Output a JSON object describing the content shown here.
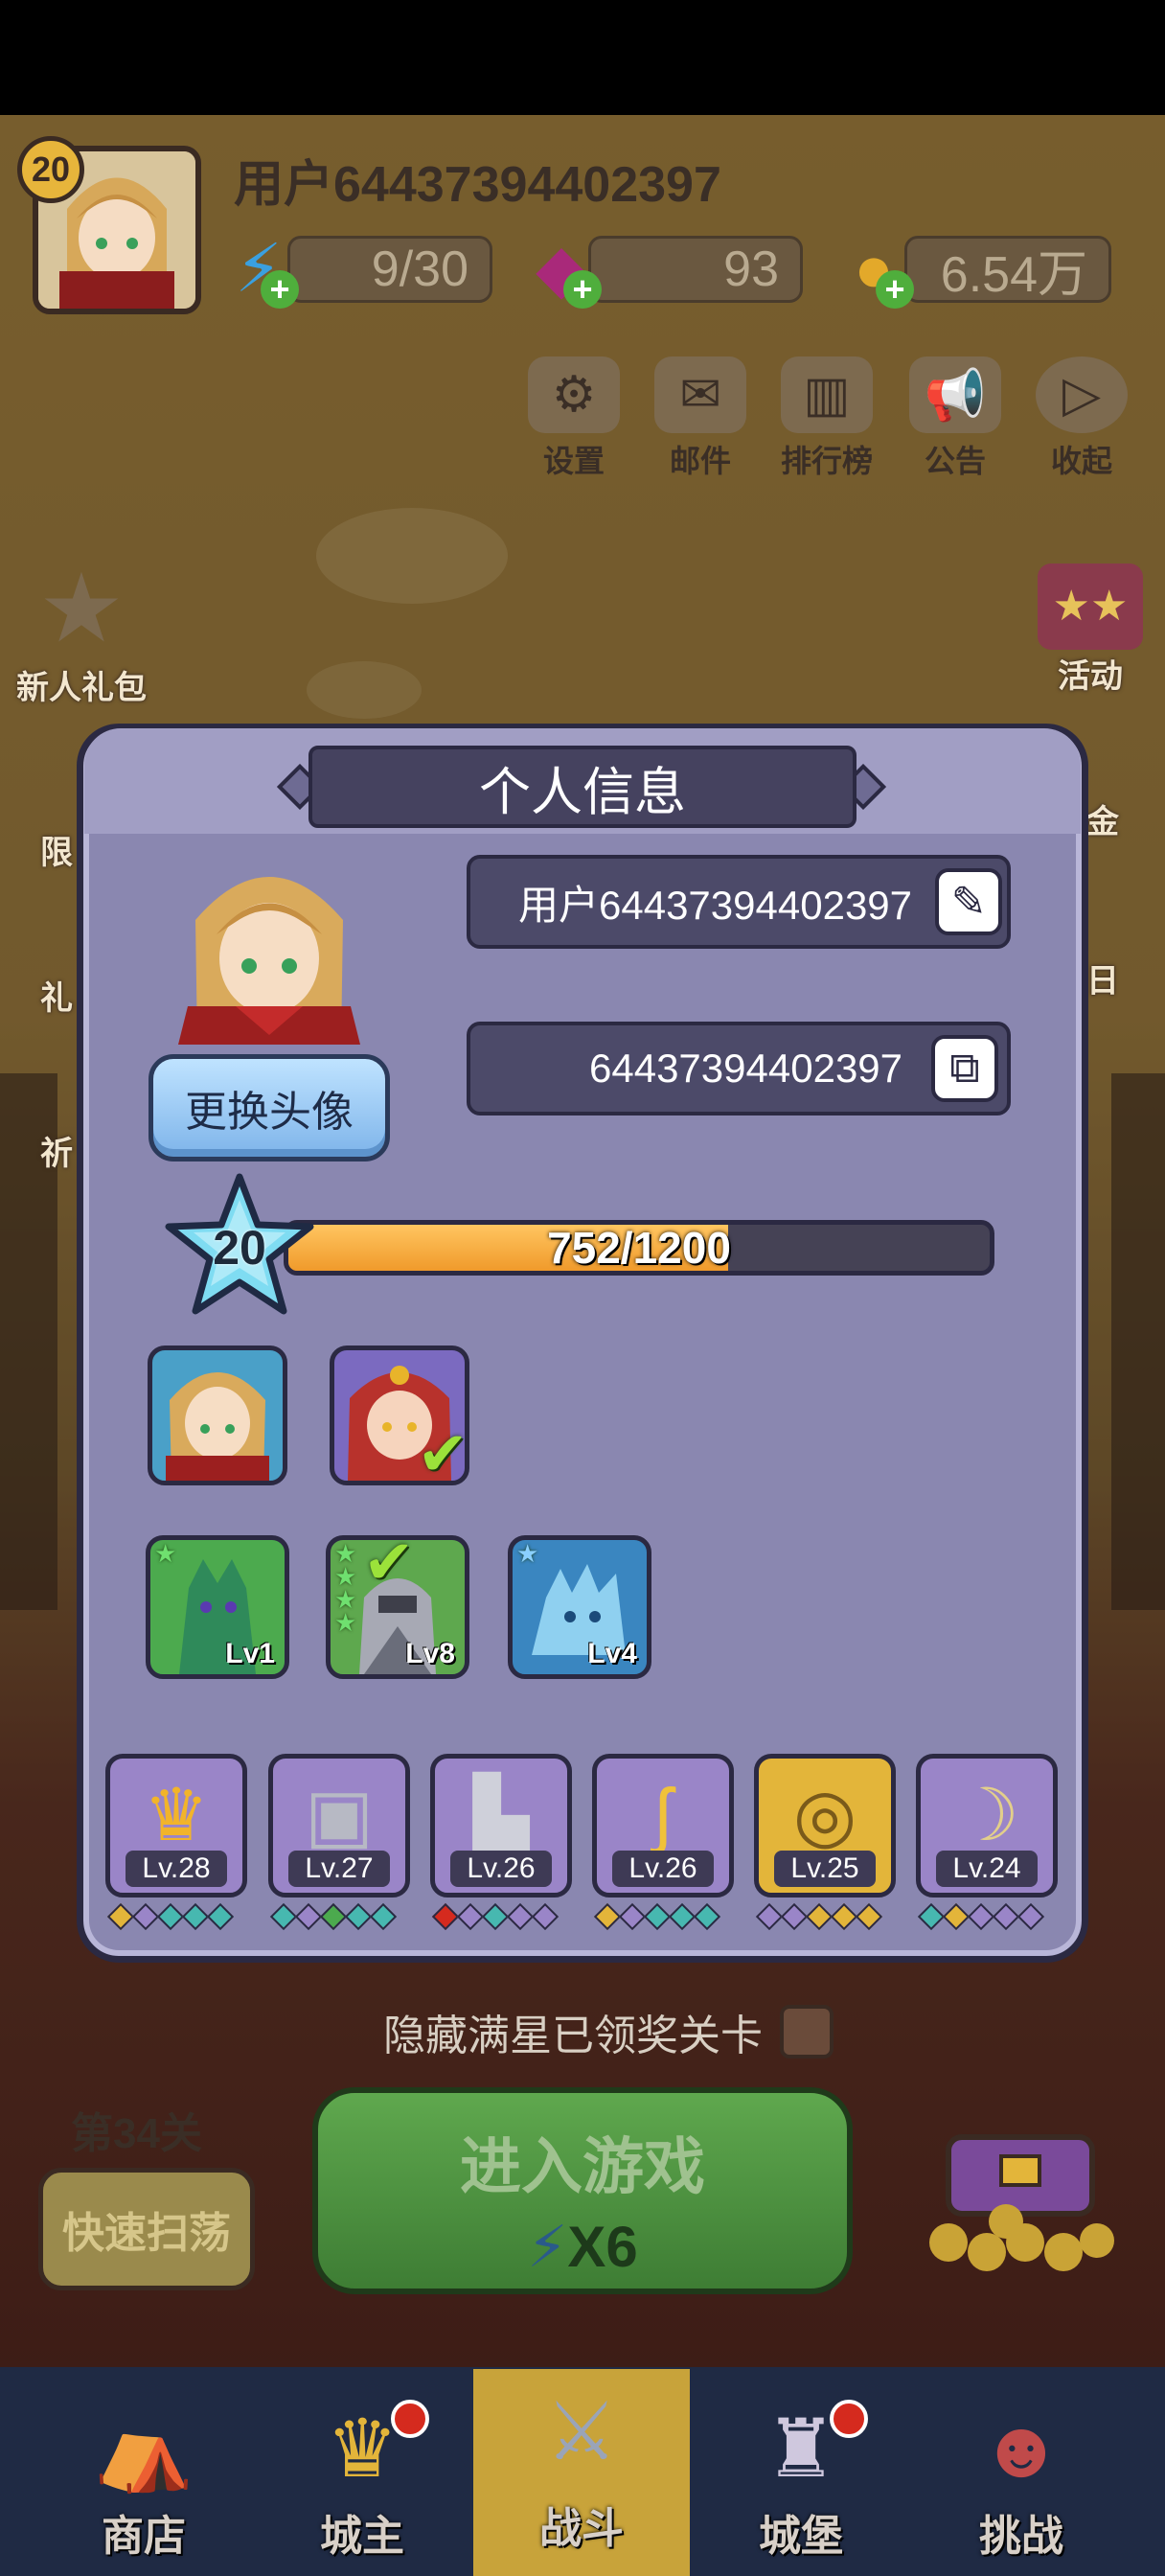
{
  "player": {
    "level": "20",
    "username": "用户64437394402397"
  },
  "resources": {
    "energy": "9/30",
    "gems": "93",
    "coins": "6.54万"
  },
  "top_buttons": [
    {
      "label": "设置",
      "icon": "gear-icon"
    },
    {
      "label": "邮件",
      "icon": "mail-icon"
    },
    {
      "label": "排行榜",
      "icon": "ranking-icon"
    },
    {
      "label": "公告",
      "icon": "megaphone-icon"
    },
    {
      "label": "收起",
      "icon": "collapse-icon"
    }
  ],
  "side_left": [
    {
      "label": "新人礼包"
    },
    {
      "label": "限"
    },
    {
      "label": "礼"
    },
    {
      "label": "祈"
    }
  ],
  "side_right": [
    {
      "label": "活动"
    },
    {
      "label": "金"
    },
    {
      "label": "日"
    }
  ],
  "profile_modal": {
    "title": "个人信息",
    "name_field": "用户64437394402397",
    "id_field": "64437394402397",
    "change_avatar_label": "更换头像",
    "level": "20",
    "xp_text": "752/1200",
    "xp_current": 752,
    "xp_max": 1200,
    "heroes": [
      {
        "name": "hero-slot-elf",
        "selected": false
      },
      {
        "name": "hero-slot-redhead",
        "selected": true
      }
    ],
    "pets": [
      {
        "level": "Lv1",
        "stars": 1,
        "selected": false
      },
      {
        "level": "Lv8",
        "stars": 4,
        "selected": true
      },
      {
        "level": "Lv4",
        "stars": 1,
        "selected": false
      }
    ],
    "equipment": [
      {
        "level": "Lv.28",
        "icon": "crown-icon"
      },
      {
        "level": "Lv.27",
        "icon": "armor-icon"
      },
      {
        "level": "Lv.26",
        "icon": "boot-icon"
      },
      {
        "level": "Lv.26",
        "icon": "staff-icon"
      },
      {
        "level": "Lv.25",
        "icon": "ring-icon"
      },
      {
        "level": "Lv.24",
        "icon": "bow-icon"
      }
    ],
    "colors": {
      "panel": "#8a87b0",
      "plate": "#45425f",
      "xp_fill": "#f5a93a"
    }
  },
  "hide_starred_label": "隐藏满星已领奖关卡",
  "stage_label": "第34关",
  "sweep_label": "快速扫荡",
  "enter_game": {
    "label": "进入游戏",
    "cost": "X6"
  },
  "bottom_nav": [
    {
      "label": "商店",
      "icon": "shop-icon"
    },
    {
      "label": "城主",
      "icon": "crown-icon"
    },
    {
      "label": "战斗",
      "icon": "swords-icon",
      "active": true
    },
    {
      "label": "城堡",
      "icon": "castle-icon"
    },
    {
      "label": "挑战",
      "icon": "demon-icon"
    }
  ]
}
